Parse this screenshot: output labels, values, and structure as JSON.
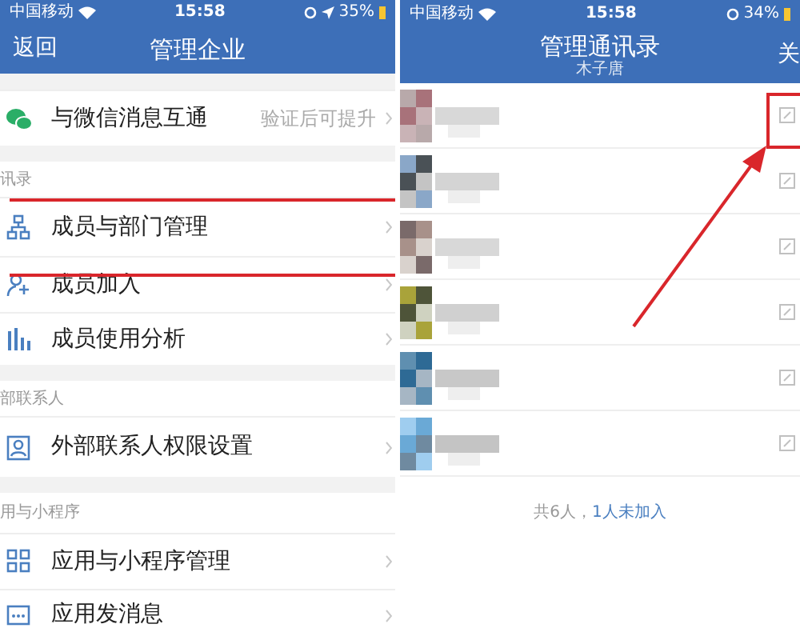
{
  "left": {
    "status_bar": {
      "carrier": "中国移动",
      "time": "15:58",
      "battery": "35%"
    },
    "nav": {
      "back": "返回",
      "title": "管理企业"
    },
    "sections": [
      {
        "items": [
          {
            "kind": "wechat",
            "text": "与微信消息互通",
            "detail": "验证后可提升"
          }
        ]
      },
      {
        "label": "讯录",
        "items": [
          {
            "kind": "org",
            "text": "成员与部门管理"
          },
          {
            "kind": "add-member",
            "text": "成员加入"
          },
          {
            "kind": "chart",
            "text": "成员使用分析"
          }
        ]
      },
      {
        "label": "部联系人",
        "items": [
          {
            "kind": "contact",
            "text": "外部联系人权限设置"
          }
        ]
      },
      {
        "label": "用与小程序",
        "items": [
          {
            "kind": "apps",
            "text": "应用与小程序管理"
          },
          {
            "kind": "message",
            "text": "应用发消息"
          }
        ]
      }
    ]
  },
  "right": {
    "status_bar": {
      "carrier": "中国移动",
      "time": "15:58",
      "battery": "34%"
    },
    "nav": {
      "title": "管理通讯录",
      "subtitle": "木子唐",
      "close": "关"
    },
    "footer": {
      "count": "共6人，",
      "pending": "1人未加入"
    }
  }
}
